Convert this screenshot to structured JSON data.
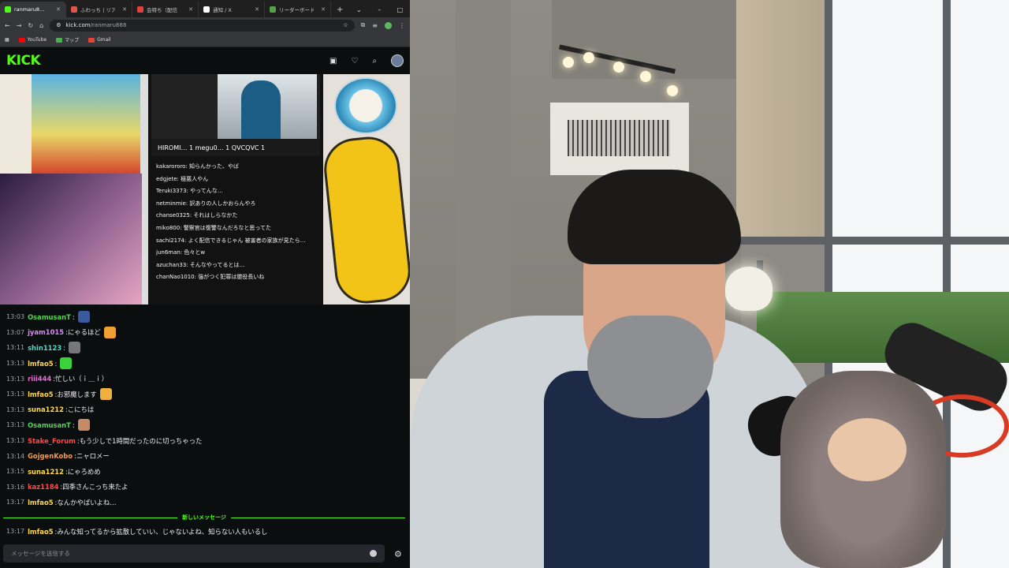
{
  "browser": {
    "tabs": [
      {
        "label": "ranmaru8…",
        "favicon_color": "#53fc18",
        "active": true
      },
      {
        "label": "ふわっち | リアル",
        "favicon_color": "#e0554a",
        "active": false
      },
      {
        "label": "会特ち（配信",
        "favicon_color": "#e04040",
        "active": false
      },
      {
        "label": "通知 / X",
        "favicon_color": "#ffffff",
        "active": false
      },
      {
        "label": "リーダーボード",
        "favicon_color": "#53a04a",
        "active": false
      }
    ],
    "new_tab": "+",
    "window_controls": [
      "⌄",
      "–",
      "□",
      "✕"
    ],
    "url_host": "kick.com",
    "url_path": "/ranmaru888",
    "bookmarks": [
      {
        "label": "YouTube",
        "color": "#ff0000"
      },
      {
        "label": "マップ",
        "color": "#4caf50"
      },
      {
        "label": "Gmail",
        "color": "#ea4335"
      }
    ]
  },
  "kick": {
    "logo": "KICK",
    "accent": "#53fc18"
  },
  "embedded_monitor": {
    "viewer_tab": "HIROMI… 1 megu0… 1 QVCQVC 1",
    "chat_lines": [
      "kakarororo: 知らんかった、やば",
      "edgjete: 極悪人やん",
      "Teruki3373: やってんな…",
      "netminmie: 訳ありの人しかおらんやろ",
      "chanse0325: それはしらなかた",
      "miko800: 警察官は復讐なんだろなと思ってた",
      "sachi2174: よく配信できるじゃん 被害者の家族が見たら…",
      "jun6man: 色々とw",
      "azuchan33: そんなやってるとは…",
      "chanNao1010: 強がつく犯罪は懲役長いね"
    ]
  },
  "chat": {
    "messages": [
      {
        "time": "13:03",
        "user": "OsamusanT",
        "color": "#5ad15a",
        "text": "",
        "emote": "#3a5aa0"
      },
      {
        "time": "13:07",
        "user": "jyam1015",
        "color": "#d58cf0",
        "text": "にゃるほど",
        "emote": "#f0a030"
      },
      {
        "time": "13:11",
        "user": "shin1123",
        "color": "#4fd9c8",
        "text": "",
        "emote": "#777777"
      },
      {
        "time": "13:13",
        "user": "lmfao5",
        "color": "#ffd94a",
        "text": "",
        "emote": "#3ad13a"
      },
      {
        "time": "13:13",
        "user": "riii444",
        "color": "#e070d0",
        "text": "忙しい（ｉ＿ｉ）",
        "emote": ""
      },
      {
        "time": "13:13",
        "user": "lmfao5",
        "color": "#ffd94a",
        "text": "お邪魔します",
        "emote": "#f0b040"
      },
      {
        "time": "13:13",
        "user": "suna1212",
        "color": "#ffd94a",
        "text": "こにちは",
        "emote": ""
      },
      {
        "time": "13:13",
        "user": "OsamusanT",
        "color": "#5ad15a",
        "text": "",
        "emote": "#c58a66"
      },
      {
        "time": "13:13",
        "user": "Stake_Forum",
        "color": "#ff4a4a",
        "text": "もう少しで1時間だったのに切っちゃった",
        "emote": ""
      },
      {
        "time": "13:14",
        "user": "GojgenKobo",
        "color": "#f29a52",
        "text": "ニャロメー",
        "emote": ""
      },
      {
        "time": "13:15",
        "user": "suna1212",
        "color": "#ffd94a",
        "text": "にゃろめめ",
        "emote": ""
      },
      {
        "time": "13:16",
        "user": "kaz1184",
        "color": "#ff4a4a",
        "text": "四季さんこっち来たよ",
        "emote": ""
      },
      {
        "time": "13:17",
        "user": "lmfao5",
        "color": "#ffd94a",
        "text": "なんかやばいよね…",
        "emote": ""
      }
    ],
    "new_messages_label": "新しいメッセージ",
    "latest": {
      "time": "13:17",
      "user": "lmfao5",
      "color": "#ffd94a",
      "text": "みんな知ってるから拡散していい、じゃないよね、知らない人もいるし"
    },
    "input_placeholder": "メッセージを送信する"
  }
}
